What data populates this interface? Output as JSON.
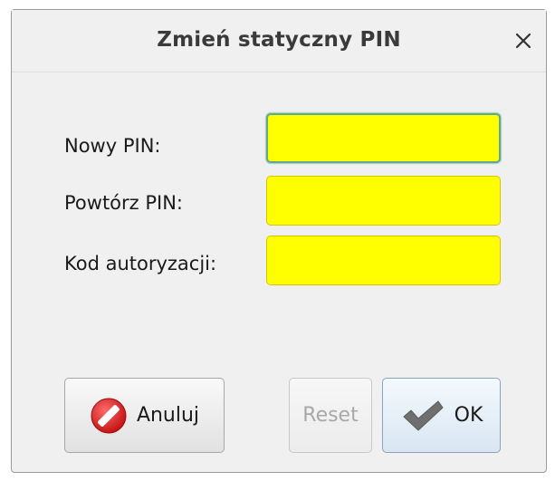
{
  "dialog": {
    "title": "Zmień statyczny PIN",
    "close_icon": "close-icon"
  },
  "form": {
    "new_pin": {
      "label": "Nowy PIN:",
      "value": ""
    },
    "repeat_pin": {
      "label": "Powtórz PIN:",
      "value": ""
    },
    "auth_code": {
      "label": "Kod autoryzacji:",
      "value": ""
    },
    "field_color": "#ffff00"
  },
  "buttons": {
    "cancel": {
      "label": "Anuluj",
      "icon": "cancel-icon",
      "color": "#d92020"
    },
    "reset": {
      "label": "Reset",
      "enabled": false
    },
    "ok": {
      "label": "OK",
      "icon": "checkmark-icon"
    }
  }
}
